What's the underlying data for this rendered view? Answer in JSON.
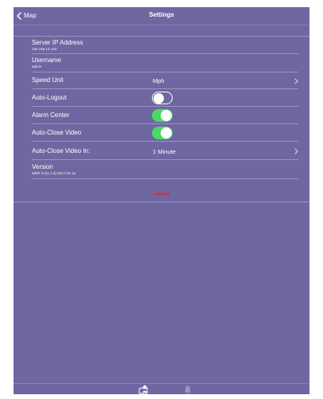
{
  "navbar": {
    "back_label": "Map",
    "title": "Settings"
  },
  "settings": {
    "server_ip": {
      "label": "Server IP Address",
      "value": "192.168.14.193"
    },
    "username": {
      "label": "Username",
      "value": "admin"
    },
    "speed_unit": {
      "label": "Speed Unit",
      "value": "Mph"
    },
    "auto_logout": {
      "label": "Auto-Logout",
      "enabled": false
    },
    "alarm_center": {
      "label": "Alarm Center",
      "enabled": true
    },
    "auto_close_video": {
      "label": "Auto-Close Video",
      "enabled": true
    },
    "auto_close_video_in": {
      "label": "Auto-Close Video In:",
      "value": "1 Minute"
    },
    "version": {
      "label": "Version",
      "value": "MDR 5.0(1.1.5) 2017-04-15"
    }
  },
  "logout_label": "Logout",
  "tabbar": {
    "tabs": [
      {
        "icon": "map-user-icon",
        "active": true
      },
      {
        "icon": "bell-icon",
        "active": false
      }
    ]
  },
  "colors": {
    "background": "#6e67a1",
    "toggle_on": "#4cd964",
    "logout": "#e2221e"
  }
}
